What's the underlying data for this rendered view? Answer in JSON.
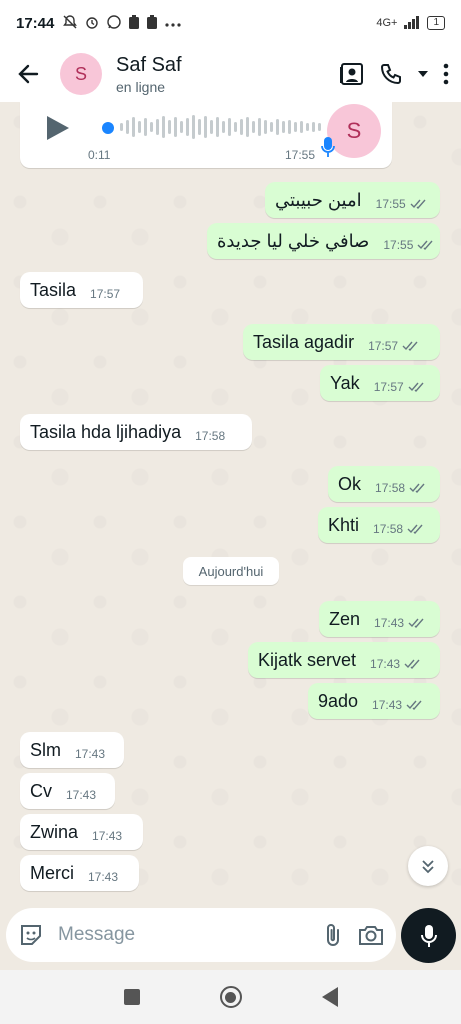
{
  "status_bar": {
    "time": "17:44",
    "network": "4G+",
    "battery": "1"
  },
  "header": {
    "contact_initial": "S",
    "contact_name": "Saf Saf",
    "contact_status": "en ligne"
  },
  "voice_message": {
    "duration": "0:11",
    "time": "17:55",
    "avatar_initial": "S"
  },
  "messages_before": [
    {
      "text": "امين حبيبتي",
      "time": "17:55",
      "dir": "out"
    },
    {
      "text": "صافي خلي ليا جديدة",
      "time": "17:55",
      "dir": "out"
    },
    {
      "text": "Tasila",
      "time": "17:57",
      "dir": "in"
    },
    {
      "text": "Tasila agadir",
      "time": "17:57",
      "dir": "out"
    },
    {
      "text": "Yak",
      "time": "17:57",
      "dir": "out"
    },
    {
      "text": "Tasila hda ljihadiya",
      "time": "17:58",
      "dir": "in"
    },
    {
      "text": "Ok",
      "time": "17:58",
      "dir": "out"
    },
    {
      "text": "Khti",
      "time": "17:58",
      "dir": "out"
    }
  ],
  "date_divider": "Aujourd'hui",
  "messages_after": [
    {
      "text": "Zen",
      "time": "17:43",
      "dir": "out"
    },
    {
      "text": "Kijatk servet",
      "time": "17:43",
      "dir": "out"
    },
    {
      "text": "9ado",
      "time": "17:43",
      "dir": "out"
    },
    {
      "text": "Slm",
      "time": "17:43",
      "dir": "in"
    },
    {
      "text": "Cv",
      "time": "17:43",
      "dir": "in"
    },
    {
      "text": "Zwina",
      "time": "17:43",
      "dir": "in"
    },
    {
      "text": "Merci",
      "time": "17:43",
      "dir": "in"
    }
  ],
  "composer": {
    "placeholder": "Message"
  },
  "colors": {
    "outgoing_bubble": "#d9fdd3",
    "incoming_bubble": "#ffffff",
    "read_ticks": "#53bdeb",
    "chat_bg": "#efeae2"
  }
}
